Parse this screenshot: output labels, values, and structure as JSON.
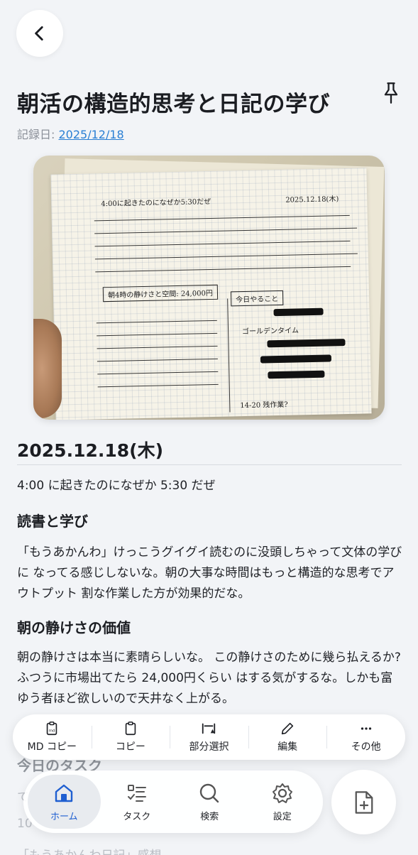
{
  "title": "朝活の構造的思考と日記の学び",
  "record_date_label": "記録日: ",
  "record_date": "2025/12/18",
  "entry_heading": "2025.12.18(木)",
  "intro": "4:00 に起きたのになぜか 5:30 だぜ",
  "section1": {
    "heading": "読書と学び",
    "body": "「もうあかんわ」けっこうグイグイ読むのに没頭しちゃって文体の学びに なってる感じしないな。朝の大事な時間はもっと構造的な思考でアウトプット 割な作業した方が効果的だな。"
  },
  "section2": {
    "heading": "朝の静けさの価値",
    "body": "朝の静けさは本当に素晴らしいな。 この静けさのために幾ら払えるか?ふつうに市場出てたら 24,000円くらい はする気がするな。しかも富ゆう者ほど欲しいので天井なく上がる。"
  },
  "hidden_heading": "今日のタスク",
  "hidden_lines": [
    "て",
    "10",
    "「もうあかんわ日記」感想"
  ],
  "photo_scribbles": {
    "line1": "4:00に起きたのになぜか5:30だぜ",
    "date": "2025.12.18(木)",
    "box": "朝4時の静けさと空間: 24,000円",
    "todo": "今日やること",
    "golden": "ゴールデンタイム",
    "ending": "14-20 残作業?"
  },
  "actions": [
    {
      "label": "MD コピー",
      "icon": "md-copy-icon"
    },
    {
      "label": "コピー",
      "icon": "clipboard-icon"
    },
    {
      "label": "部分選択",
      "icon": "partial-select-icon"
    },
    {
      "label": "編集",
      "icon": "pencil-icon"
    },
    {
      "label": "その他",
      "icon": "more-icon"
    }
  ],
  "tabs": [
    {
      "label": "ホーム",
      "icon": "home-icon",
      "active": true
    },
    {
      "label": "タスク",
      "icon": "task-list-icon",
      "active": false
    },
    {
      "label": "検索",
      "icon": "search-icon",
      "active": false
    },
    {
      "label": "設定",
      "icon": "gear-icon",
      "active": false
    }
  ],
  "colors": {
    "accent": "#1f5fd1",
    "link": "#2a7fd4",
    "background": "#f2f4f7"
  }
}
